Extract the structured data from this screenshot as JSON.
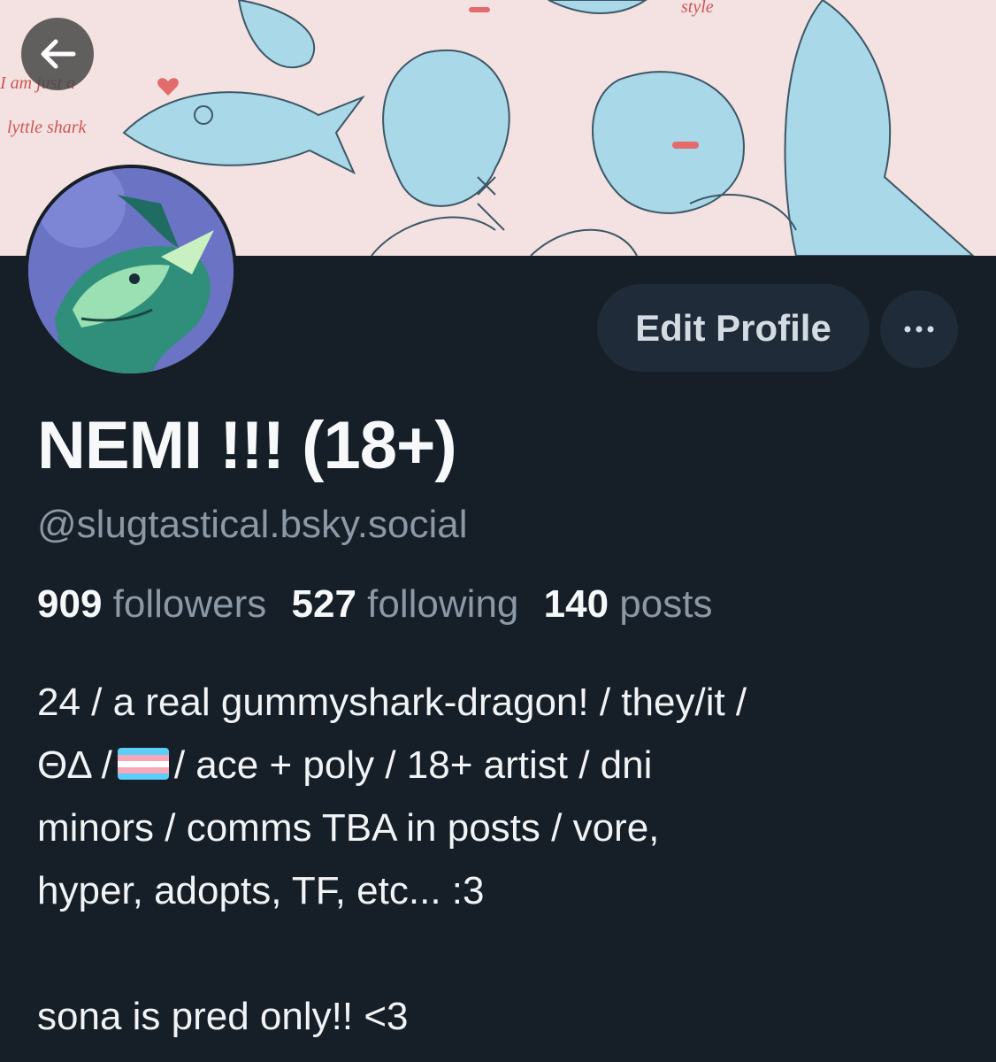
{
  "profile": {
    "display_name": "NEMI !!! (18+)",
    "handle": "@slugtastical.bsky.social",
    "edit_button_label": "Edit Profile",
    "more_button_label": "···",
    "stats": {
      "followers_count": "909",
      "followers_label": "followers",
      "following_count": "527",
      "following_label": "following",
      "posts_count": "140",
      "posts_label": "posts"
    },
    "bio": {
      "line1": "24 / a real gummyshark-dragon! / they/it /",
      "line2_before_flag": "ΘΔ /",
      "line2_after_flag": "/ ace + poly / 18+ artist / dni",
      "line3": "minors / comms TBA in posts / vore,",
      "line4": "hyper, adopts, TF, etc... :3",
      "line5": "sona is pred only!! <3"
    }
  },
  "banner": {
    "sketch_text_1": "I am just a",
    "sketch_text_2": "lyttle shark",
    "sketch_text_3": "style"
  },
  "icons": {
    "back": "arrow-left-icon",
    "more": "ellipsis-icon",
    "flag": "transgender-flag-icon"
  },
  "colors": {
    "background": "#161e27",
    "button_bg": "#1f2b38",
    "muted_text": "#8b98a6",
    "banner_bg": "#f3e2e1",
    "sketch_blue": "#9fd3e6"
  }
}
